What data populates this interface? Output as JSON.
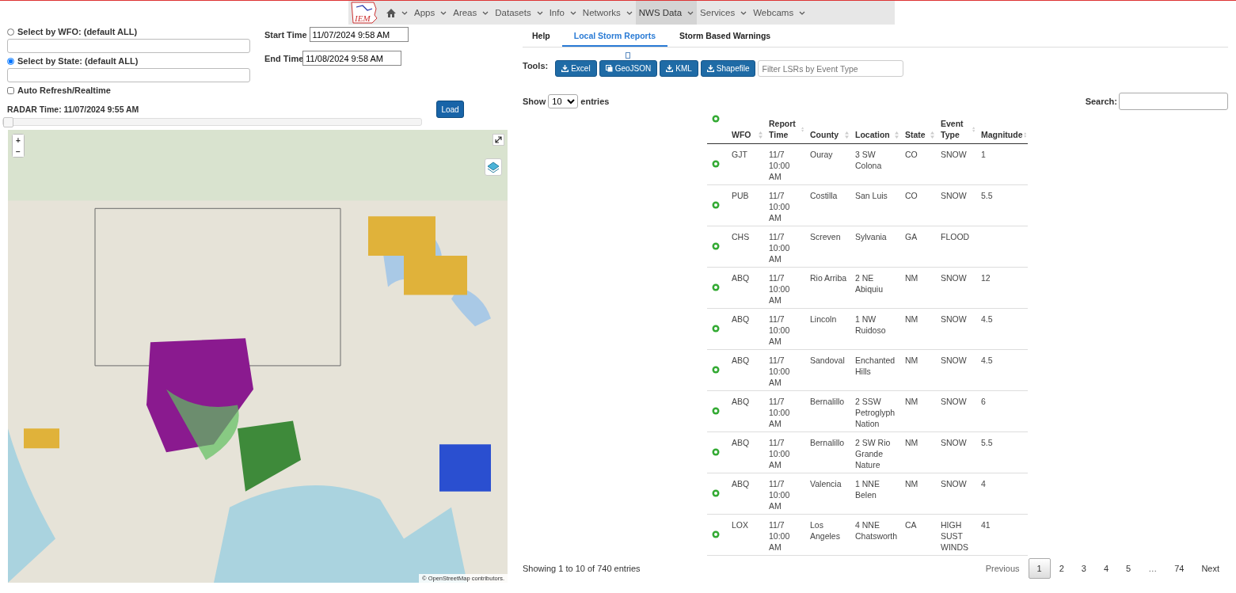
{
  "nav": {
    "logo": "IEM",
    "items": [
      {
        "kind": "home",
        "selected": false
      },
      {
        "label": "Apps",
        "selected": false
      },
      {
        "label": "Areas",
        "selected": false
      },
      {
        "label": "Datasets",
        "selected": false
      },
      {
        "label": "Info",
        "selected": false
      },
      {
        "label": "Networks",
        "selected": false
      },
      {
        "label": "NWS Data",
        "selected": true
      },
      {
        "label": "Services",
        "selected": false
      },
      {
        "label": "Webcams",
        "selected": false
      }
    ]
  },
  "filters": {
    "wfo": {
      "label": "Select by WFO: (default ALL)",
      "selected": false
    },
    "state": {
      "label": "Select by State: (default ALL)",
      "selected": true
    },
    "auto_refresh": {
      "label": "Auto Refresh/Realtime",
      "checked": false
    },
    "start_time": {
      "label": "Start Time",
      "value": "11/07/2024 9:58 AM"
    },
    "end_time": {
      "label": "End Time",
      "value": "11/08/2024 9:58 AM"
    },
    "radar_time": "RADAR Time: 11/07/2024 9:55 AM",
    "load": "Load",
    "radar_slider": {
      "level": 0
    }
  },
  "map": {
    "zoom_in": "+",
    "zoom_out": "−",
    "attribution": "© OpenStreetMap contributors."
  },
  "tabs": [
    {
      "label": "Help",
      "selected": false
    },
    {
      "label": "Local Storm Reports",
      "selected": true
    },
    {
      "label": "Storm Based Warnings",
      "selected": false
    }
  ],
  "tools": {
    "label": "Tools:",
    "buttons": [
      {
        "label": "Excel",
        "kind": "download"
      },
      {
        "label": "GeoJSON",
        "kind": "copy"
      },
      {
        "label": "KML",
        "kind": "download"
      },
      {
        "label": "Shapefile",
        "kind": "download"
      }
    ],
    "filter_placeholder": "Filter LSRs by Event Type"
  },
  "length": {
    "before": "Show",
    "value": "10",
    "after": "entries"
  },
  "search": {
    "label": "Search:"
  },
  "table": {
    "columns": [
      "WFO",
      "Report Time",
      "County",
      "Location",
      "State",
      "Event Type",
      "Magnitude"
    ],
    "rows": [
      {
        "wfo": "GJT",
        "time": "11/7 10:00 AM",
        "county": "Ouray",
        "location": "3 SW Colona",
        "state": "CO",
        "type": "SNOW",
        "magnitude": "1"
      },
      {
        "wfo": "PUB",
        "time": "11/7 10:00 AM",
        "county": "Costilla",
        "location": "San Luis",
        "state": "CO",
        "type": "SNOW",
        "magnitude": "5.5"
      },
      {
        "wfo": "CHS",
        "time": "11/7 10:00 AM",
        "county": "Screven",
        "location": "Sylvania",
        "state": "GA",
        "type": "FLOOD"
      },
      {
        "wfo": "ABQ",
        "time": "11/7 10:00 AM",
        "county": "Rio Arriba",
        "location": "2 NE Abiquiu",
        "state": "NM",
        "type": "SNOW",
        "magnitude": "12"
      },
      {
        "wfo": "ABQ",
        "time": "11/7 10:00 AM",
        "county": "Lincoln",
        "location": "1 NW Ruidoso",
        "state": "NM",
        "type": "SNOW",
        "magnitude": "4.5"
      },
      {
        "wfo": "ABQ",
        "time": "11/7 10:00 AM",
        "county": "Sandoval",
        "location": "Enchanted Hills",
        "state": "NM",
        "type": "SNOW",
        "magnitude": "4.5"
      },
      {
        "wfo": "ABQ",
        "time": "11/7 10:00 AM",
        "county": "Bernalillo",
        "location": "2 SSW Petroglyph Nation",
        "state": "NM",
        "type": "SNOW",
        "magnitude": "6"
      },
      {
        "wfo": "ABQ",
        "time": "11/7 10:00 AM",
        "county": "Bernalillo",
        "location": "2 SW Rio Grande Nature",
        "state": "NM",
        "type": "SNOW",
        "magnitude": "5.5"
      },
      {
        "wfo": "ABQ",
        "time": "11/7 10:00 AM",
        "county": "Valencia",
        "location": "1 NNE Belen",
        "state": "NM",
        "type": "SNOW",
        "magnitude": "4"
      },
      {
        "wfo": "LOX",
        "time": "11/7 10:00 AM",
        "county": "Los Angeles",
        "location": "4 NNE Chatsworth",
        "state": "CA",
        "type": "HIGH SUST WINDS",
        "magnitude": "41"
      }
    ]
  },
  "info": "Showing 1 to 10 of 740 entries",
  "pagination": [
    {
      "label": "Previous",
      "kind": "prev",
      "disabled": true
    },
    {
      "label": "1",
      "kind": "page",
      "selected": true
    },
    {
      "label": "2",
      "kind": "page",
      "selected": false
    },
    {
      "label": "3",
      "kind": "page",
      "selected": false
    },
    {
      "label": "4",
      "kind": "page",
      "selected": false
    },
    {
      "label": "5",
      "kind": "page",
      "selected": false
    },
    {
      "label": "…",
      "kind": "ellipsis"
    },
    {
      "label": "74",
      "kind": "page",
      "selected": false
    },
    {
      "label": "Next",
      "kind": "next",
      "disabled": false
    }
  ]
}
